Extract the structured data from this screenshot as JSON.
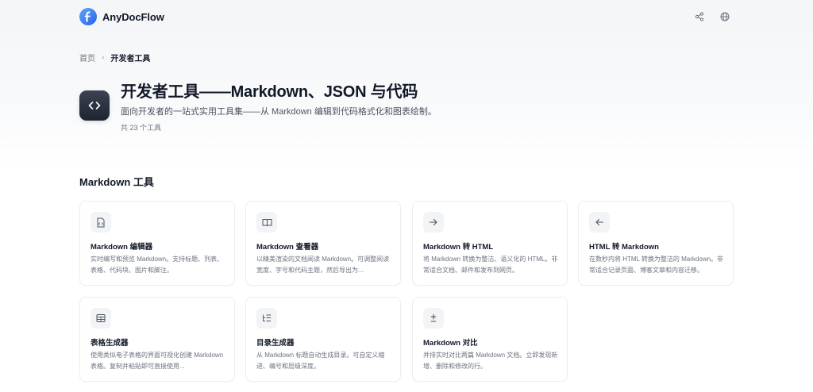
{
  "header": {
    "brand": "AnyDocFlow",
    "icons": [
      "share-icon",
      "globe-icon"
    ]
  },
  "breadcrumb": {
    "home": "首页",
    "separator": "›",
    "current": "开发者工具"
  },
  "hero": {
    "icon": "code-brackets-icon",
    "title": "开发者工具——Markdown、JSON 与代码",
    "subtitle": "面向开发者的一站式实用工具集——从 Markdown 编辑到代码格式化和图表绘制。",
    "count": "共 23 个工具"
  },
  "section": {
    "title": "Markdown 工具",
    "tools": [
      {
        "icon": "markdown-file-icon",
        "title": "Markdown 编辑器",
        "desc": "实时编写和预览 Markdown。支持标题、列表、表格、代码块、图片和脚注。"
      },
      {
        "icon": "book-open-icon",
        "title": "Markdown 查看器",
        "desc": "以精美渲染的文档阅读 Markdown。可调整阅读宽度、字号和代码主题，然后导出为..."
      },
      {
        "icon": "arrow-right-icon",
        "title": "Markdown 转 HTML",
        "desc": "将 Markdown 转换为整洁、语义化的 HTML。非常适合文档、邮件和发布到网页。"
      },
      {
        "icon": "arrow-left-icon",
        "title": "HTML 转 Markdown",
        "desc": "在数秒内将 HTML 转换为整洁的 Markdown。非常适合记录页面、博客文章和内容迁移。"
      },
      {
        "icon": "table-icon",
        "title": "表格生成器",
        "desc": "使用类似电子表格的界面可视化创建 Markdown 表格。复制并粘贴即可直接使用..."
      },
      {
        "icon": "list-tree-icon",
        "title": "目录生成器",
        "desc": "从 Markdown 标题自动生成目录。可自定义缩进、编号和层级深度。"
      },
      {
        "icon": "plus-minus-icon",
        "title": "Markdown 对比",
        "desc": "并排实时对比两篇 Markdown 文档。立即发现新增、删除和修改的行。"
      }
    ]
  },
  "colors": {
    "brand": "#2563eb",
    "hero_icon_bg": "#2a303b",
    "card_border": "#ebedf0"
  }
}
